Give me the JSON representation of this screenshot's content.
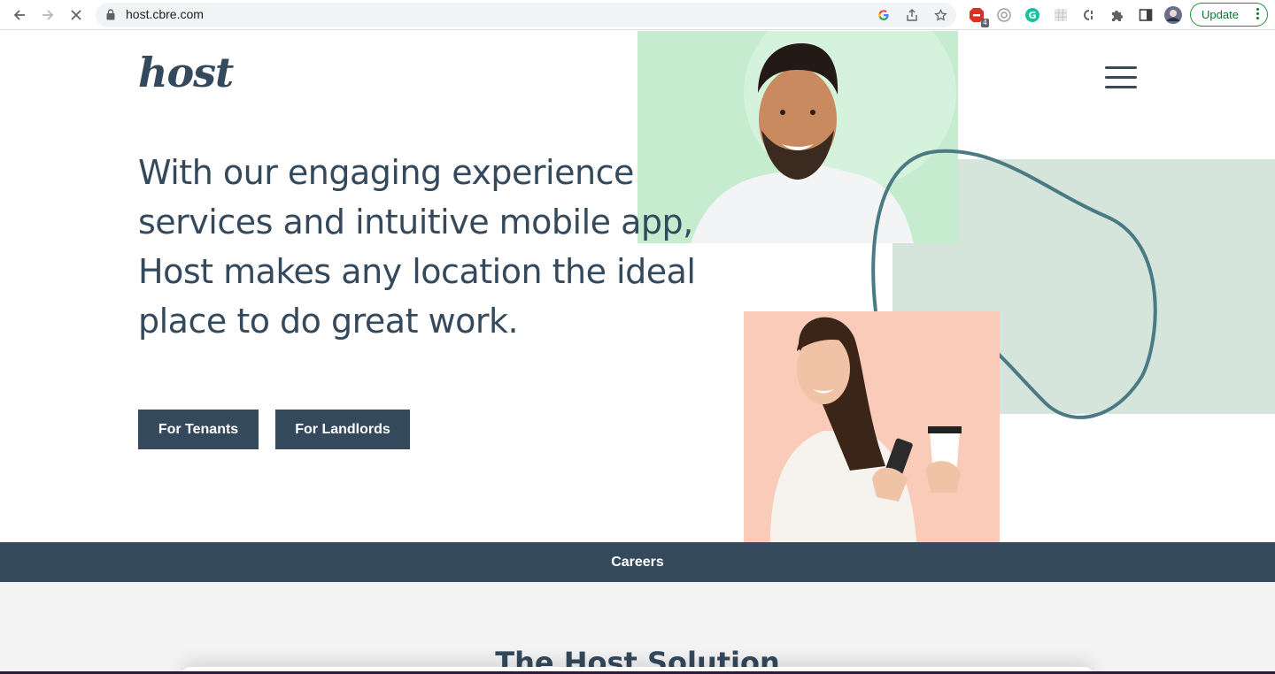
{
  "browser": {
    "url": "host.cbre.com",
    "update_label": "Update",
    "extension_badge": "4",
    "icons": [
      "back-icon",
      "forward-icon",
      "stop-loading-icon",
      "lock-icon",
      "google-icon",
      "share-icon",
      "bookmark-star-icon",
      "extension-icon",
      "puzzle-icon",
      "side-panel-icon",
      "profile-avatar",
      "more-icon"
    ]
  },
  "header": {
    "logo": "host",
    "menu_icon": "hamburger-menu-icon"
  },
  "hero": {
    "headline": "With our engaging experience services and intuitive mobile app, Host makes any location the ideal place to do great work.",
    "buttons": {
      "tenants": "For Tenants",
      "landlords": "For Landlords"
    }
  },
  "careers_bar": {
    "label": "Careers"
  },
  "solution": {
    "title": "The Host Solution"
  },
  "colors": {
    "brand_navy": "#34495c",
    "accent_green": "#d6e5dc",
    "photo_green": "#c6ecd0",
    "photo_peach": "#f9cbb8",
    "blob_stroke": "#4a7a84",
    "chrome_green": "#137333"
  }
}
